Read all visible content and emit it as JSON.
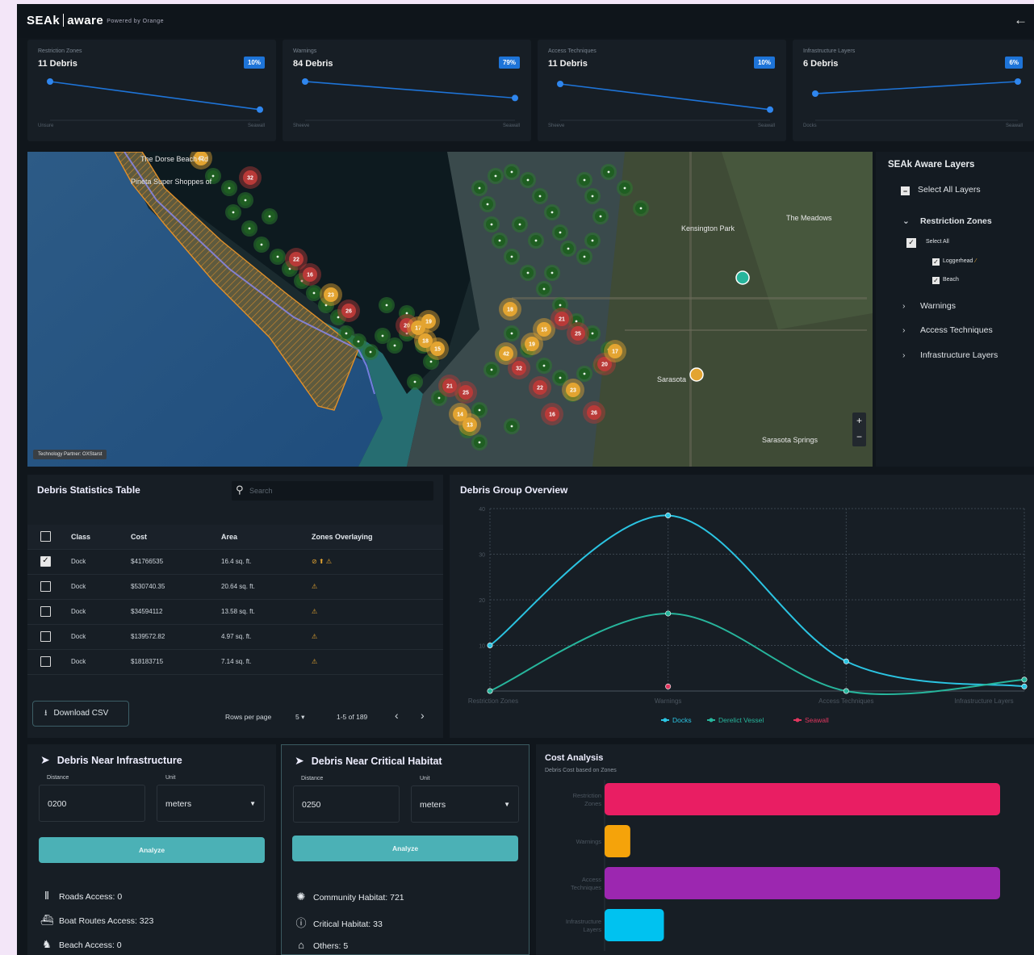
{
  "app": {
    "brand_main": "SEAk",
    "brand_second": "aware",
    "brand_tagline": "Powered by Orange",
    "back_icon": "arrow-left-icon"
  },
  "cards": [
    {
      "label": "Restriction Zones",
      "value": "11 Debris",
      "percent": "10%",
      "axis_start": "Unsure",
      "axis_end": "Seawall",
      "trend": [
        0.8,
        0.22
      ]
    },
    {
      "label": "Warnings",
      "value": "84 Debris",
      "percent": "79%",
      "axis_start": "Sheeve",
      "axis_end": "Seawall",
      "trend": [
        0.8,
        0.46
      ]
    },
    {
      "label": "Access Techniques",
      "value": "11 Debris",
      "percent": "10%",
      "axis_start": "Sheeve",
      "axis_end": "Seawall",
      "trend": [
        0.75,
        0.22
      ]
    },
    {
      "label": "Infrastructure Layers",
      "value": "6 Debris",
      "percent": "6%",
      "axis_start": "Docks",
      "axis_end": "Seawall",
      "trend": [
        0.55,
        0.8
      ]
    }
  ],
  "map": {
    "place_labels": [
      "The Dorse Beach Rd",
      "Pineta Super Shoppes of",
      "Kensington Park",
      "The Meadows",
      "Sarasota",
      "Sarasota Springs"
    ],
    "credit": "Technology Partner: OXStarst",
    "zoom_in": "+",
    "zoom_out": "−",
    "clusters": [
      {
        "label": "42",
        "color": "#e3a431"
      },
      {
        "label": "32",
        "color": "#b93a38"
      },
      {
        "label": "22",
        "color": "#b93a38"
      },
      {
        "label": "16",
        "color": "#b93a38"
      },
      {
        "label": "23",
        "color": "#e3a431"
      },
      {
        "label": "26",
        "color": "#b93a38"
      },
      {
        "label": "20",
        "color": "#b93a38"
      },
      {
        "label": "17",
        "color": "#e3a431"
      },
      {
        "label": "18",
        "color": "#e3a431"
      },
      {
        "label": "19",
        "color": "#e3a431"
      },
      {
        "label": "15",
        "color": "#e3a431"
      },
      {
        "label": "21",
        "color": "#b93a38"
      },
      {
        "label": "25",
        "color": "#b93a38"
      },
      {
        "label": "14",
        "color": "#e3a431"
      },
      {
        "label": "13",
        "color": "#e3a431"
      }
    ]
  },
  "layers": {
    "title": "SEAk Aware Layers",
    "select_all": "Select All Layers",
    "sections": [
      {
        "label": "Restriction Zones",
        "expanded": true,
        "select": "Select All",
        "items": [
          "Loggerhead",
          "Beach"
        ]
      },
      {
        "label": "Warnings",
        "expanded": false
      },
      {
        "label": "Access Techniques",
        "expanded": false
      },
      {
        "label": "Infrastructure Layers",
        "expanded": false
      }
    ]
  },
  "table": {
    "title": "Debris Statistics Table",
    "search_placeholder": "Search",
    "columns": [
      "Class",
      "Cost",
      "Area",
      "Zones Overlaying"
    ],
    "rows": [
      {
        "checked": true,
        "class": "Dock",
        "cost": "$41766535",
        "area": "16.4 sq. ft.",
        "zones": "⊘ ⬆ ⚠"
      },
      {
        "checked": false,
        "class": "Dock",
        "cost": "$530740.35",
        "area": "20.64 sq. ft.",
        "zones": "⚠"
      },
      {
        "checked": false,
        "class": "Dock",
        "cost": "$34594112",
        "area": "13.58 sq. ft.",
        "zones": "⚠"
      },
      {
        "checked": false,
        "class": "Dock",
        "cost": "$139572.82",
        "area": "4.97 sq. ft.",
        "zones": "⚠"
      },
      {
        "checked": false,
        "class": "Dock",
        "cost": "$18183715",
        "area": "7.14 sq. ft.",
        "zones": "⚠"
      }
    ],
    "download": "Download CSV",
    "rows_per_page_label": "Rows per page",
    "rows_per_page": "5",
    "range": "1-5 of 189",
    "prev": "‹",
    "next": "›"
  },
  "chart_data": {
    "type": "line",
    "title": "Debris Group Overview",
    "categories": [
      "Restriction Zones",
      "Warnings",
      "Access Techniques",
      "Infrastructure Layers"
    ],
    "ylim": [
      0,
      40
    ],
    "yticks": [
      10,
      20,
      30,
      40
    ],
    "series": [
      {
        "name": "Docks",
        "color": "#2bc4e2",
        "values": [
          10,
          38.5,
          6.5,
          1
        ]
      },
      {
        "name": "Derelict Vessel",
        "color": "#27b59c",
        "values": [
          0,
          17,
          0,
          2.5
        ]
      },
      {
        "name": "Seawall",
        "color": "#e0365e",
        "values": [
          null,
          1,
          null,
          null
        ]
      }
    ],
    "grid": true,
    "legend": "bottom"
  },
  "infra": {
    "title": "Debris Near Infrastructure",
    "distance_label": "Distance",
    "distance": "0200",
    "unit_label": "Unit",
    "unit": "meters",
    "analyze": "Analyze",
    "stats": [
      {
        "icon": "road-icon",
        "label": "Roads Access: 0"
      },
      {
        "icon": "ferry-icon",
        "label": "Boat Routes Access: 323"
      },
      {
        "icon": "hiking-icon",
        "label": "Beach Access: 0"
      }
    ]
  },
  "habitat": {
    "title": "Debris Near Critical Habitat",
    "distance_label": "Distance",
    "distance": "0250",
    "unit_label": "Unit",
    "unit": "meters",
    "analyze": "Analyze",
    "stats": [
      {
        "icon": "community-icon",
        "label": "Community Habitat: 721"
      },
      {
        "icon": "alert-circle-icon",
        "label": "Critical Habitat: 33"
      },
      {
        "icon": "others-icon",
        "label": "Others: 5"
      }
    ]
  },
  "cost": {
    "title": "Cost Analysis",
    "subtitle": "Debris Cost based on Zones",
    "chart_data": {
      "type": "bar",
      "orientation": "horizontal",
      "categories": [
        "Restriction Zones",
        "Warnings",
        "Access Techniques",
        "Infrastructure Layers"
      ],
      "values": [
        100,
        6.5,
        100,
        15
      ],
      "colors": [
        "#e91e63",
        "#f5a30a",
        "#9c27b0",
        "#00c2f0"
      ],
      "xlim": [
        0,
        100
      ]
    }
  }
}
